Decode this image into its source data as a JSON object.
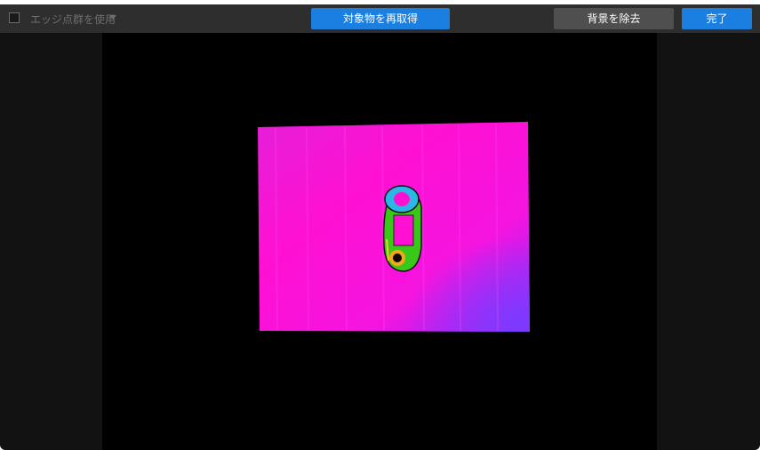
{
  "toolbar": {
    "edge_checkbox_checked": false,
    "edge_points_label": "エッジ点群を使用",
    "reacquire_label": "対象物を再取得",
    "remove_background_label": "背景を除去",
    "done_label": "完了"
  },
  "colors": {
    "primary_button": "#1a7fe0",
    "secondary_button": "#4f4f4f",
    "toolbar_bg": "#2e2e2e",
    "viewport_bg": "#000000"
  }
}
